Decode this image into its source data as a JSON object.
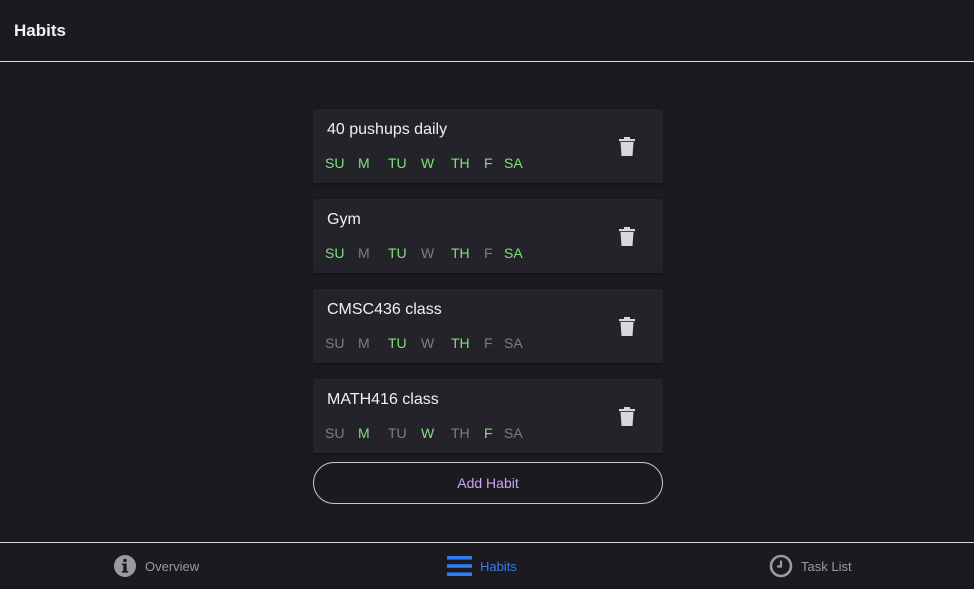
{
  "header": {
    "title": "Habits"
  },
  "habits": [
    {
      "name": "40 pushups daily",
      "days": [
        {
          "label": "SU",
          "active": true
        },
        {
          "label": "M",
          "active": true
        },
        {
          "label": "TU",
          "active": true
        },
        {
          "label": "W",
          "active": true
        },
        {
          "label": "TH",
          "active": true
        },
        {
          "label": "F",
          "active": true
        },
        {
          "label": "SA",
          "active": true
        }
      ]
    },
    {
      "name": "Gym",
      "days": [
        {
          "label": "SU",
          "active": true
        },
        {
          "label": "M",
          "active": false
        },
        {
          "label": "TU",
          "active": true
        },
        {
          "label": "W",
          "active": false
        },
        {
          "label": "TH",
          "active": true
        },
        {
          "label": "F",
          "active": false
        },
        {
          "label": "SA",
          "active": true
        }
      ]
    },
    {
      "name": "CMSC436 class",
      "days": [
        {
          "label": "SU",
          "active": false
        },
        {
          "label": "M",
          "active": false
        },
        {
          "label": "TU",
          "active": true
        },
        {
          "label": "W",
          "active": false
        },
        {
          "label": "TH",
          "active": true
        },
        {
          "label": "F",
          "active": false
        },
        {
          "label": "SA",
          "active": false
        }
      ]
    },
    {
      "name": "MATH416 class",
      "days": [
        {
          "label": "SU",
          "active": false
        },
        {
          "label": "M",
          "active": true
        },
        {
          "label": "TU",
          "active": false
        },
        {
          "label": "W",
          "active": true
        },
        {
          "label": "TH",
          "active": false
        },
        {
          "label": "F",
          "active": true
        },
        {
          "label": "SA",
          "active": false
        }
      ]
    }
  ],
  "add_button": {
    "label": "Add Habit"
  },
  "nav": {
    "items": [
      {
        "label": "Overview",
        "icon": "info-icon",
        "active": false
      },
      {
        "label": "Habits",
        "icon": "list-icon",
        "active": true
      },
      {
        "label": "Task List",
        "icon": "clock-icon",
        "active": false
      }
    ]
  },
  "colors": {
    "background": "#1b1a1f",
    "card": "#242329",
    "active_day": "#7fe27a",
    "inactive_day": "#7d7d82",
    "accent_nav": "#2f7cf6",
    "button_text": "#c8a6f5"
  }
}
